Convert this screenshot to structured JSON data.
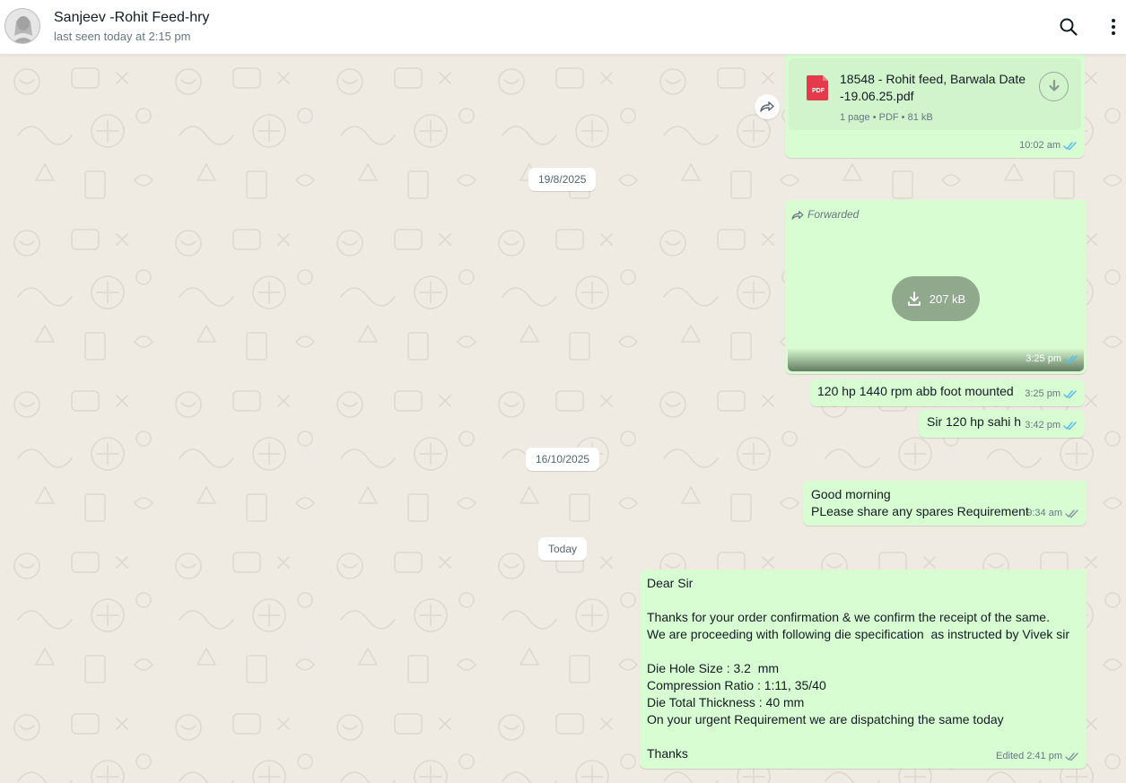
{
  "header": {
    "contact_name": "Sanjeev -Rohit Feed-hry",
    "last_seen": "last seen today at 2:15 pm"
  },
  "icons": {
    "search": "search-icon",
    "menu": "kebab-menu-icon",
    "forward": "forward-icon",
    "download": "download-icon",
    "pdf": "pdf-file-icon",
    "ticks": "double-check-icon"
  },
  "colors": {
    "bubble_out": "#d9fdd3",
    "chat_bg": "#efeae2",
    "read_ticks": "#53bdeb",
    "sent_ticks": "#8696a0",
    "pdf_red": "#e53a4c"
  },
  "messages": {
    "pdf": {
      "file_name_line1": "18548 - Rohit feed, Barwala Date",
      "file_name_line2": "-19.06.25.pdf",
      "details": "1 page • PDF • 81 kB",
      "time": "10:02 am",
      "pdf_badge": "PDF"
    },
    "date1": "19/8/2025",
    "forwarded_media": {
      "forwarded_label": "Forwarded",
      "size": "207 kB",
      "time": "3:25 pm"
    },
    "msg_120hp": {
      "text": "120 hp 1440 rpm abb foot mounted",
      "time": "3:25 pm"
    },
    "msg_sahi": {
      "text": "Sir 120 hp sahi h",
      "time": "3:42 pm"
    },
    "date2": "16/10/2025",
    "msg_morning": {
      "line1": "Good morning",
      "line2": "PLease share any spares Requirement",
      "time": "9:34 am"
    },
    "date3": "Today",
    "msg_final": {
      "l1": "Dear Sir",
      "l2": "Thanks for your order confirmation & we confirm the receipt of the same.",
      "l3": "We are proceeding with following die specification  as instructed by Vivek sir",
      "l4": "Die Hole Size : 3.2  mm",
      "l5": "Compression Ratio : 1:11, 35/40",
      "l6": "Die Total Thickness : 40 mm",
      "l7": "On your urgent Requirement we are dispatching the same today",
      "l8": "Thanks",
      "edited": "Edited",
      "time": "2:41 pm"
    }
  }
}
